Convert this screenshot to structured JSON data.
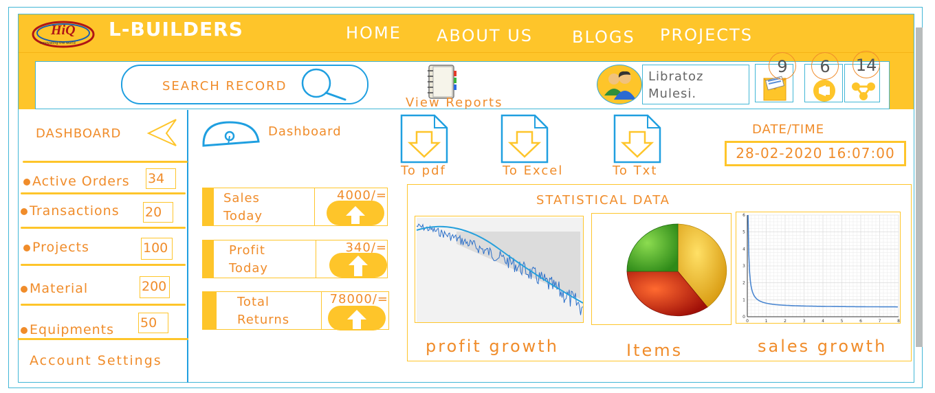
{
  "brand": {
    "name": "L-BUILDERS",
    "logo_text": "HiQ",
    "logo_tagline": "Innovating the world"
  },
  "nav": {
    "home": "HOME",
    "about": "ABOUT US",
    "blogs": "BLOGS",
    "projects": "PROJECTS"
  },
  "search": {
    "label": "SEARCH RECORD"
  },
  "reports": {
    "label": "View Reports"
  },
  "user": {
    "first": "Libratoz",
    "last": "Mulesi."
  },
  "notifications": [
    {
      "icon": "mail-icon",
      "count": "9"
    },
    {
      "icon": "megaphone-icon",
      "count": "6"
    },
    {
      "icon": "share-icon",
      "count": "14"
    }
  ],
  "sidebar": {
    "title": "DASHBOARD",
    "items": [
      {
        "label": "Active Orders",
        "count": "34"
      },
      {
        "label": "Transactions",
        "count": "20"
      },
      {
        "label": "Projects",
        "count": "100"
      },
      {
        "label": "Material",
        "count": "200"
      },
      {
        "label": "Equipments",
        "count": "50"
      }
    ],
    "account": "Account Settings"
  },
  "main": {
    "title": "Dashboard",
    "exports": [
      {
        "label": "To pdf"
      },
      {
        "label": "To Excel"
      },
      {
        "label": "To Txt"
      }
    ],
    "datetime": {
      "label": "DATE/TIME",
      "value": "28-02-2020 16:07:00"
    },
    "stats": [
      {
        "line1": "Sales",
        "line2": "Today",
        "value": "4000/="
      },
      {
        "line1": "Profit",
        "line2": "Today",
        "value": "340/="
      },
      {
        "line1": "Total",
        "line2": "Returns",
        "value": "78000/="
      }
    ],
    "statistical": {
      "title": "STATISTICAL DATA",
      "captions": [
        "profit growth",
        "Items",
        "sales growth"
      ]
    }
  },
  "chart_data": [
    {
      "type": "line",
      "caption": "profit growth"
    },
    {
      "type": "pie",
      "caption": "Items",
      "slice_colors": [
        "#e8b21c",
        "#c92a12",
        "#4caf28"
      ]
    },
    {
      "type": "line",
      "caption": "sales growth",
      "x_ticks": [
        "0",
        "1",
        "2",
        "3",
        "4",
        "5",
        "6",
        "7",
        "8"
      ],
      "y_ticks": [
        "0",
        "1",
        "2",
        "3",
        "4",
        "5",
        "6"
      ]
    }
  ],
  "colors": {
    "accent": "#fec52a",
    "text": "#f08c2a",
    "outline": "#1f9fe0"
  }
}
